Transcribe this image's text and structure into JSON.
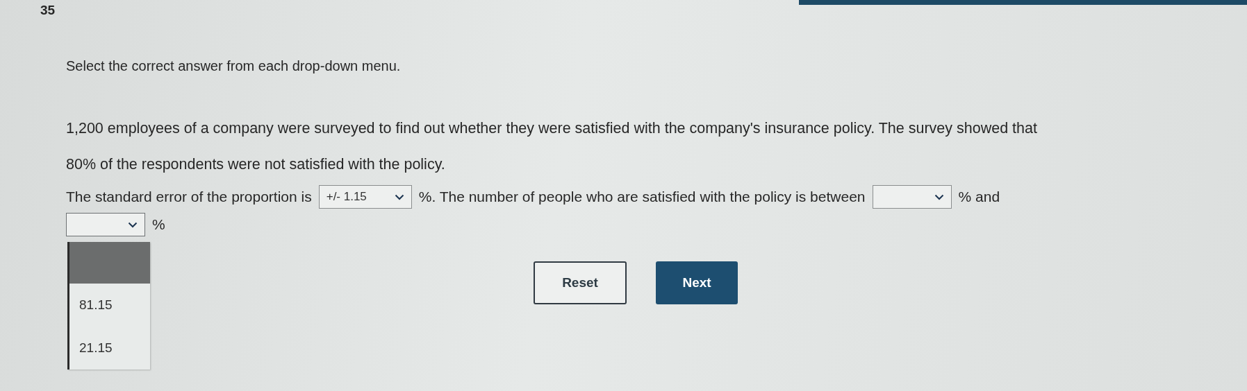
{
  "question_number": "35",
  "instruction": "Select the correct answer from each drop-down menu.",
  "problem": "1,200 employees of a company were surveyed to find out whether they were satisfied with the company's insurance policy. The survey showed that 80% of the respondents were not satisfied with the policy.",
  "sentence": [
    {
      "kind": "text",
      "text": "The standard error of the proportion is"
    },
    {
      "kind": "dropdown",
      "value": "+/- 1.15",
      "open": false
    },
    {
      "kind": "text",
      "text": "%. The number of people who are satisfied with the policy is between"
    },
    {
      "kind": "dropdown",
      "open": false
    },
    {
      "kind": "text",
      "text": "% and"
    },
    {
      "kind": "dropdown",
      "open": true
    },
    {
      "kind": "text",
      "text": "%"
    }
  ],
  "open_menu": {
    "blank_row_highlighted": true,
    "options": [
      "81.15",
      "21.15"
    ]
  },
  "buttons": [
    {
      "label": "Reset",
      "kind": "secondary"
    },
    {
      "label": "Next",
      "kind": "primary"
    }
  ]
}
